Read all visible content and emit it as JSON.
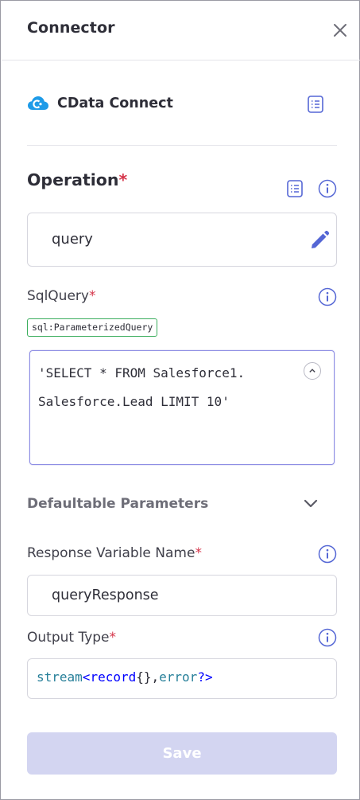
{
  "header": {
    "title": "Connector"
  },
  "connector": {
    "name": "CData Connect"
  },
  "operation": {
    "label": "Operation",
    "required_mark": "*",
    "value": "query"
  },
  "sql_query": {
    "label": "SqlQuery",
    "required_mark": "*",
    "type_badge": "sql:ParameterizedQuery",
    "lines": [
      "'SELECT * FROM Salesforce1.",
      "Salesforce.Lead LIMIT 10'"
    ]
  },
  "defaultable": {
    "label": "Defaultable Parameters"
  },
  "response_variable": {
    "label": "Response Variable Name",
    "required_mark": "*",
    "value": "queryResponse"
  },
  "output_type": {
    "label": "Output Type",
    "required_mark": "*",
    "tokens": [
      "stream",
      "<",
      "record",
      "{},",
      "error",
      "?>"
    ]
  },
  "save_label": "Save",
  "colors": {
    "accent": "#5567d5",
    "required": "#d5354a",
    "save_disabled": "#d3d5f1",
    "badge_border": "#3cae5e",
    "editor_border": "#8e8ee4"
  },
  "icons": [
    "close-icon",
    "cloud-connector-icon",
    "document-icon",
    "info-icon",
    "pencil-icon",
    "collapse-up-icon",
    "chevron-down-icon"
  ]
}
